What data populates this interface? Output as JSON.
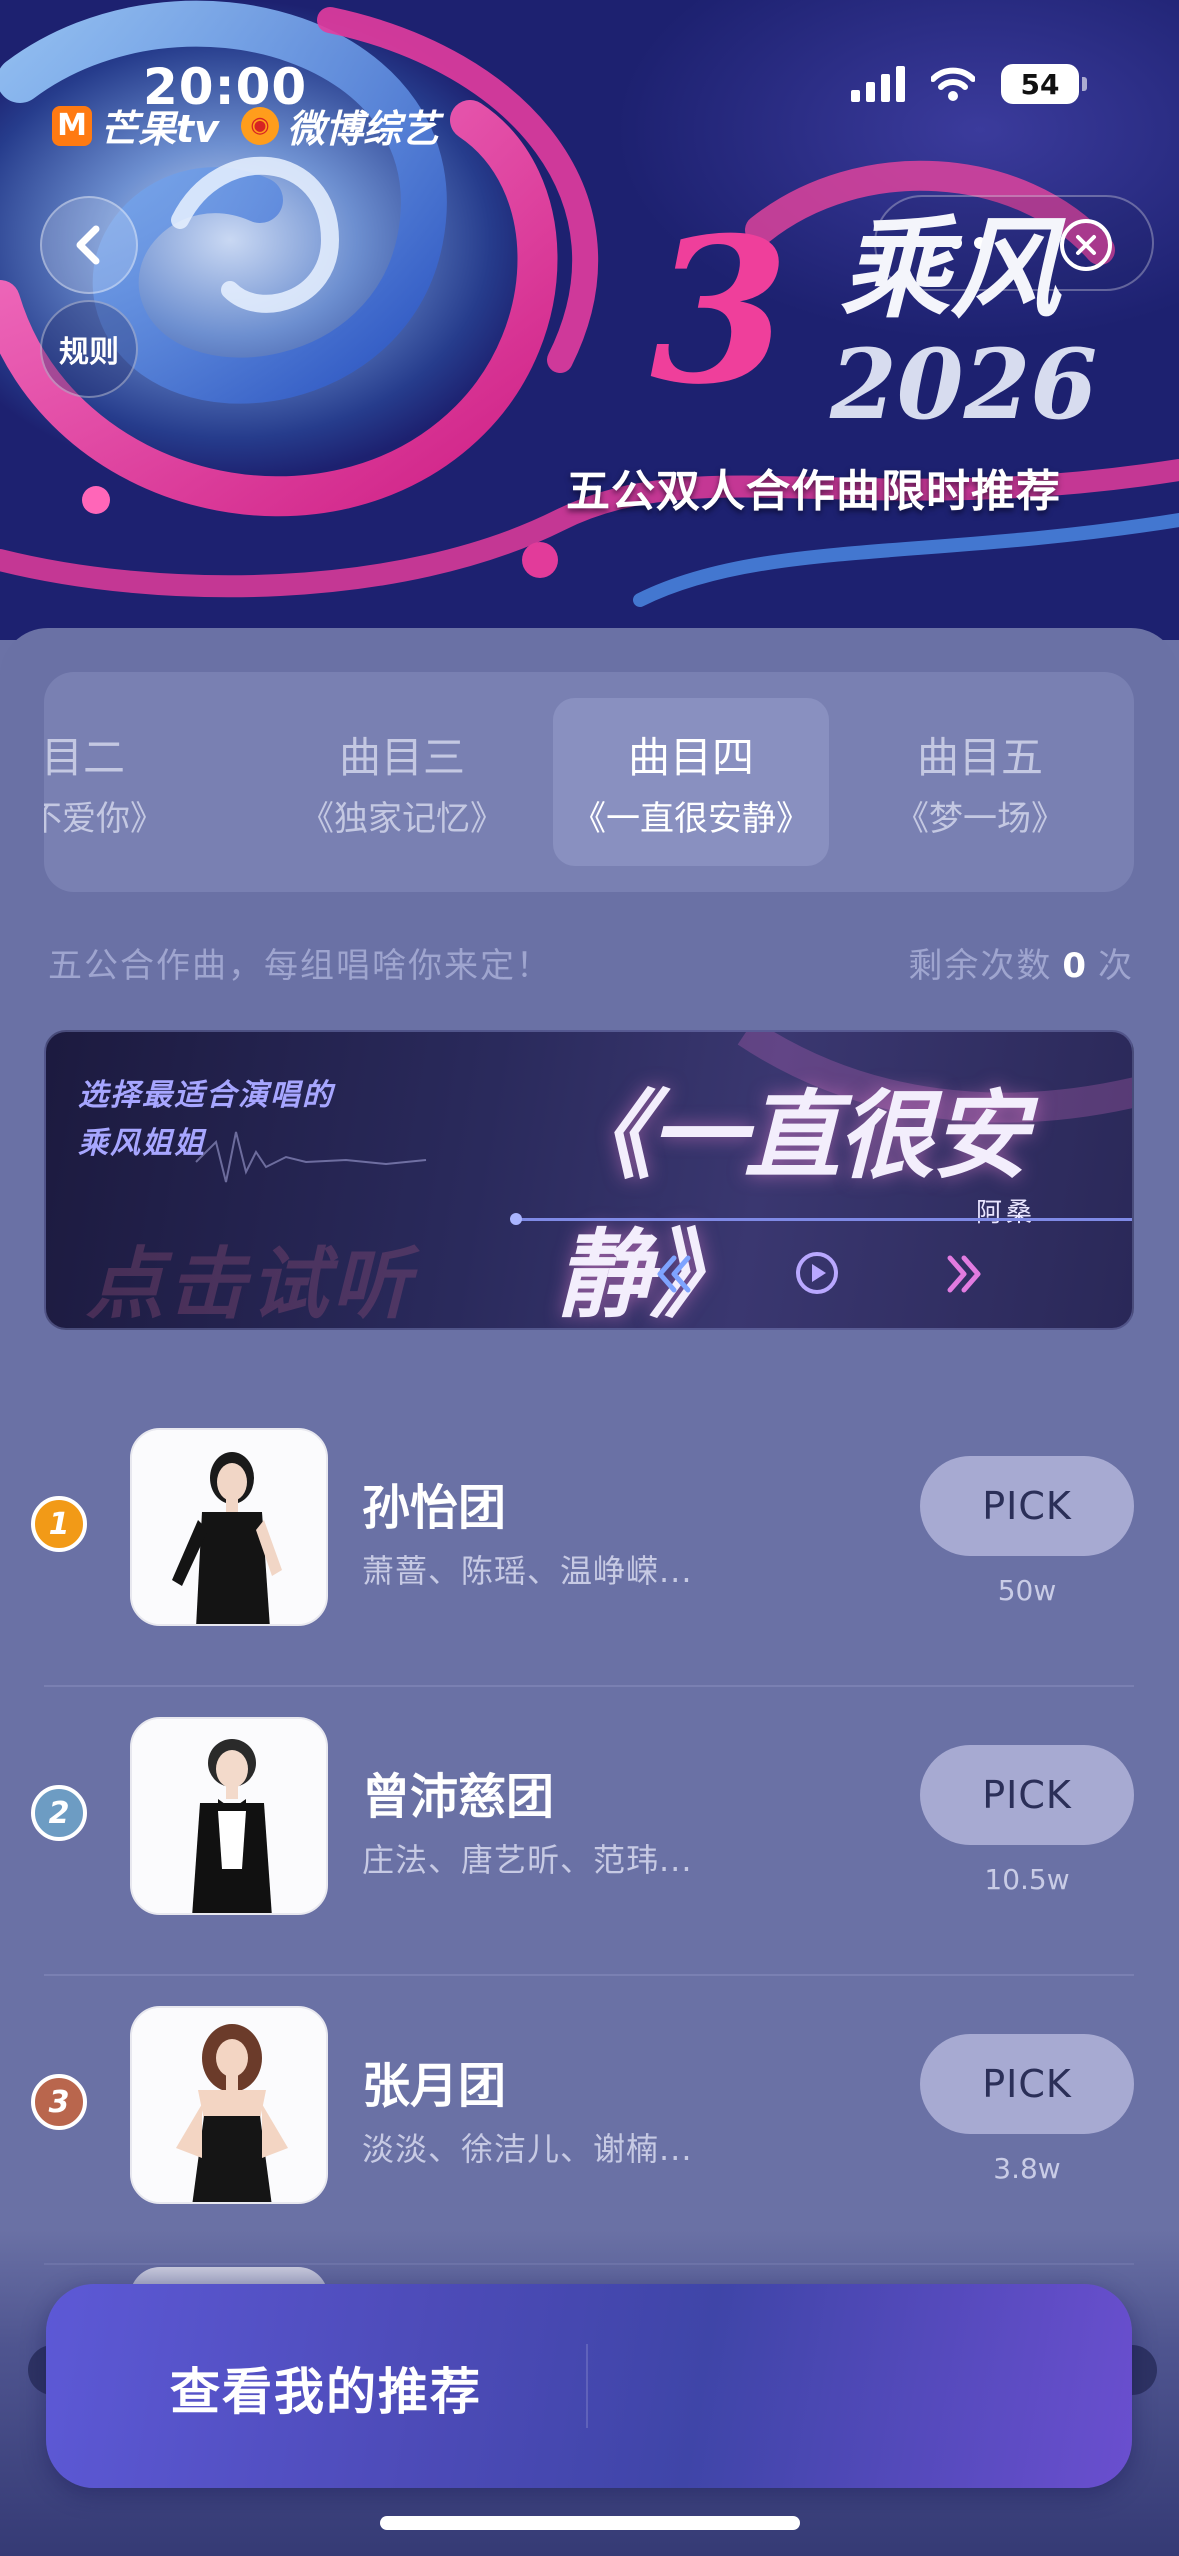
{
  "status_bar": {
    "time": "20:00",
    "battery": "54"
  },
  "hero": {
    "logos": {
      "mango": "芒果tv",
      "weibo": "微博综艺"
    },
    "rules_label": "规则",
    "brand_number": "3",
    "brand_name": "乘风",
    "brand_year": "2026",
    "subtitle": "五公双人合作曲限时推荐"
  },
  "tabs": [
    {
      "title": "曲目二",
      "song": "说我不爱你》",
      "active": false
    },
    {
      "title": "曲目三",
      "song": "《独家记忆》",
      "active": false
    },
    {
      "title": "曲目四",
      "song": "《一直很安静》",
      "active": true
    },
    {
      "title": "曲目五",
      "song": "《梦一场》",
      "active": false
    }
  ],
  "tabs_first_title_partial": "目二",
  "info": {
    "hint": "五公合作曲，每组唱啥你来定！",
    "remaining_label": "剩余次数",
    "remaining_count": "0",
    "remaining_unit": "次"
  },
  "player": {
    "tagline_line1": "选择最适合演唱的",
    "tagline_line2": "乘风姐姐",
    "song_title": "《一直很安静》",
    "singer": "阿桑",
    "try_listen": "点击试听"
  },
  "ranking": [
    {
      "rank": "1",
      "rank_color": "#f29a17",
      "team": "孙怡团",
      "members": "萧蔷、陈瑶、温峥嵘...",
      "pick_label": "PICK",
      "votes": "50w"
    },
    {
      "rank": "2",
      "rank_color": "#6d9cc3",
      "team": "曾沛慈团",
      "members": "庄法、唐艺昕、范玮...",
      "pick_label": "PICK",
      "votes": "10.5w"
    },
    {
      "rank": "3",
      "rank_color": "#b9664d",
      "team": "张月团",
      "members": "淡淡、徐洁儿、谢楠...",
      "pick_label": "PICK",
      "votes": "3.8w"
    }
  ],
  "cta": {
    "label": "查看我的推荐"
  },
  "colors": {
    "accent_pink": "#ef3f9b",
    "panel_bg": "#6a71a5",
    "pick_button": "#a7aad2"
  }
}
